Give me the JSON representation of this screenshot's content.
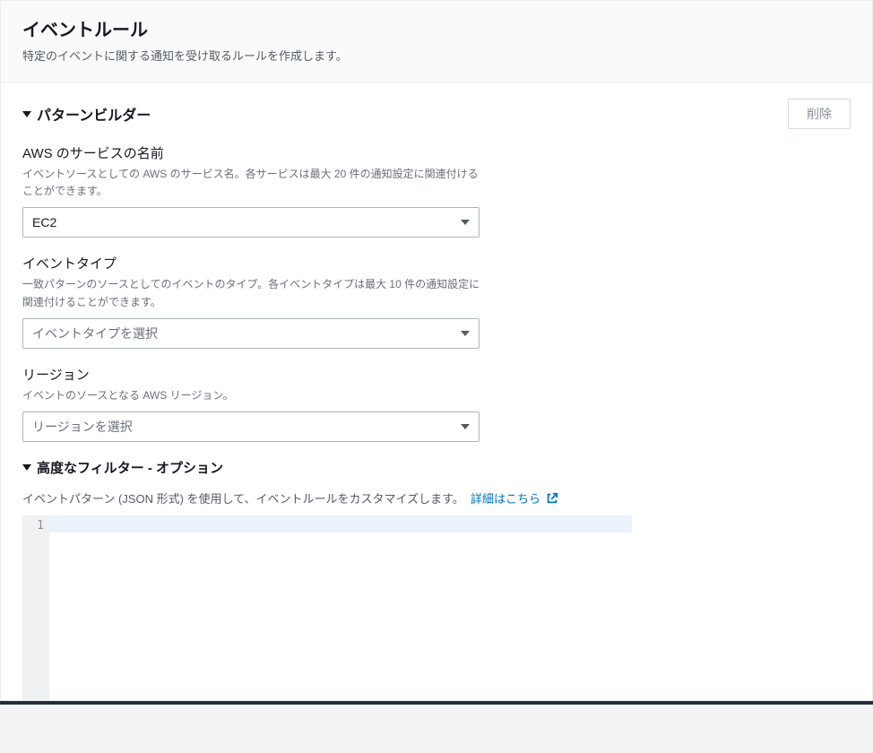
{
  "header": {
    "title": "イベントルール",
    "subtitle": "特定のイベントに関する通知を受け取るルールを作成します。"
  },
  "patternBuilder": {
    "title": "パターンビルダー",
    "deleteLabel": "削除",
    "service": {
      "label": "AWS のサービスの名前",
      "desc": "イベントソースとしての AWS のサービス名。各サービスは最大 20 件の通知設定に関連付けることができます。",
      "value": "EC2"
    },
    "eventType": {
      "label": "イベントタイプ",
      "desc": "一致パターンのソースとしてのイベントのタイプ。各イベントタイプは最大 10 件の通知設定に関連付けることができます。",
      "placeholder": "イベントタイプを選択"
    },
    "region": {
      "label": "リージョン",
      "desc": "イベントのソースとなる AWS リージョン。",
      "placeholder": "リージョンを選択"
    }
  },
  "advancedFilter": {
    "title": "高度なフィルター - オプション",
    "desc": "イベントパターン (JSON 形式) を使用して、イベントルールをカスタマイズします。",
    "learnMore": "詳細はこちら",
    "gutter": "1"
  }
}
